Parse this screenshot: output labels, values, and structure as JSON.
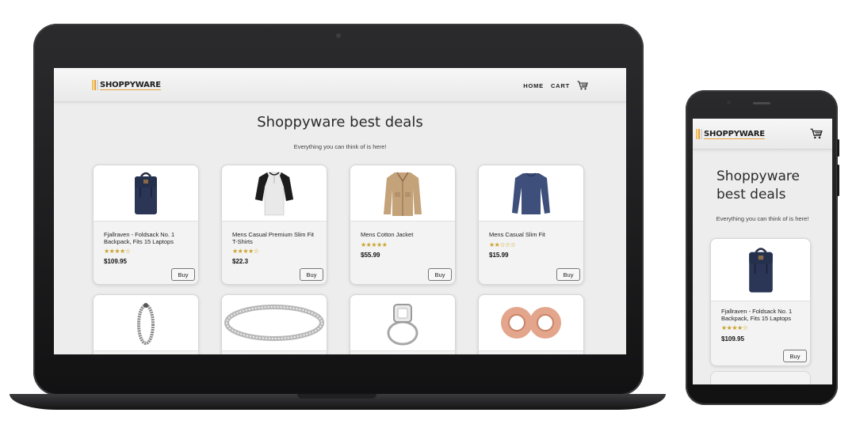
{
  "site": {
    "logo_text": "SHOPPYWARE",
    "nav": {
      "home": "HOME",
      "cart": "CART"
    },
    "hero_title": "Shoppyware best deals",
    "hero_subtitle": "Everything you can think of is here!"
  },
  "products": [
    {
      "name": "Fjallraven - Foldsack No. 1 Backpack, Fits 15 Laptops",
      "rating": 3.5,
      "stars": "★★★★☆",
      "price": "$109.95",
      "buy": "Buy",
      "image": "backpack"
    },
    {
      "name": "Mens Casual Premium Slim Fit T-Shirts",
      "rating": 4,
      "stars": "★★★★☆",
      "price": "$22.3",
      "buy": "Buy",
      "image": "raglan-shirt"
    },
    {
      "name": "Mens Cotton Jacket",
      "rating": 5,
      "stars": "★★★★★",
      "price": "$55.99",
      "buy": "Buy",
      "image": "jacket"
    },
    {
      "name": "Mens Casual Slim Fit",
      "rating": 2,
      "stars": "★★☆☆☆",
      "price": "$15.99",
      "buy": "Buy",
      "image": "long-sleeve"
    },
    {
      "name": "",
      "image": "bracelet"
    },
    {
      "name": "",
      "image": "ring-band"
    },
    {
      "name": "",
      "image": "diamond-ring"
    },
    {
      "name": "",
      "image": "rose-gold-plugs"
    }
  ],
  "mobile": {
    "logo_text": "SHOPPYWARE",
    "hero_title_line1": "Shoppyware",
    "hero_title_line2": "best deals",
    "hero_subtitle": "Everything you can think of is here!",
    "product": {
      "name": "Fjallraven - Foldsack No. 1 Backpack, Fits 15 Laptops",
      "stars": "★★★★☆",
      "price": "$109.95",
      "buy": "Buy"
    }
  },
  "colors": {
    "star": "#c9a227",
    "logo_underline": "#e8a13a",
    "device_frame": "#1b1b1c"
  },
  "icons": [
    "cart-icon",
    "logo-mark-icon"
  ]
}
